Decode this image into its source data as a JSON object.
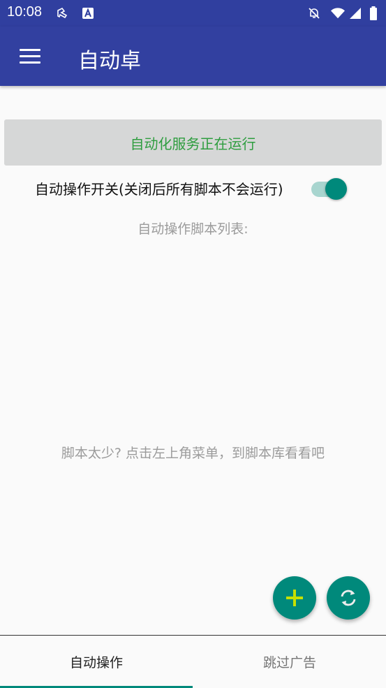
{
  "status_bar": {
    "time": "10:08",
    "icons": [
      "usb-debug-icon",
      "a-app-icon",
      "notifications-off-icon",
      "wifi-icon",
      "signal-icon",
      "battery-icon"
    ]
  },
  "app_bar": {
    "title": "自动卓",
    "menu_icon": "menu-icon",
    "color": "#3240a0"
  },
  "main": {
    "service_status": "自动化服务正在运行",
    "master_switch": {
      "label": "自动操作开关(关闭后所有脚本不会运行)",
      "on": true
    },
    "list_header": "自动操作脚本列表:",
    "empty_hint": "脚本太少? 点击左上角菜单，到脚本库看看吧"
  },
  "fabs": {
    "add_icon": "plus-icon",
    "refresh_icon": "refresh-icon",
    "accent": "#00897b",
    "plus_color": "#c6e000"
  },
  "bottom_nav": {
    "tabs": [
      {
        "label": "自动操作",
        "active": true
      },
      {
        "label": "跳过广告",
        "active": false
      }
    ]
  }
}
